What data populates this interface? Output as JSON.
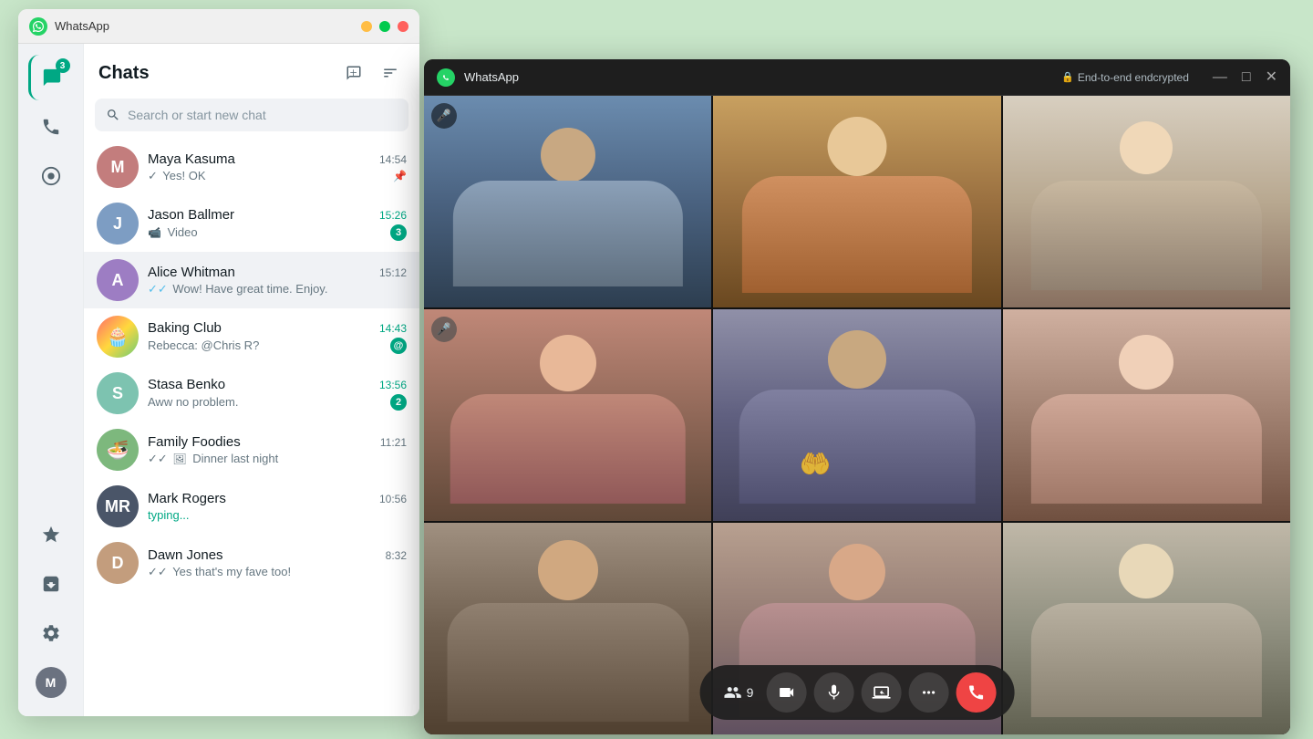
{
  "outerWindow": {
    "titlebar": {
      "appName": "WhatsApp",
      "controls": {
        "minimize": "—",
        "maximize": "□",
        "close": "✕"
      }
    }
  },
  "sidebar": {
    "badge": "3",
    "items": [
      {
        "id": "chats",
        "label": "Chats",
        "icon": "chat"
      },
      {
        "id": "calls",
        "label": "Calls",
        "icon": "phone"
      },
      {
        "id": "status",
        "label": "Status",
        "icon": "circle"
      }
    ],
    "bottomItems": [
      {
        "id": "favorites",
        "label": "Favorites",
        "icon": "star"
      },
      {
        "id": "archived",
        "label": "Archived",
        "icon": "archive"
      },
      {
        "id": "settings",
        "label": "Settings",
        "icon": "gear"
      },
      {
        "id": "profile",
        "label": "Profile",
        "icon": "avatar"
      }
    ]
  },
  "chatsPanel": {
    "title": "Chats",
    "newChatLabel": "New chat",
    "filterLabel": "Filter",
    "search": {
      "placeholder": "Search or start new chat"
    },
    "conversations": [
      {
        "id": "maya",
        "name": "Maya Kasuma",
        "time": "14:54",
        "preview": "Yes! OK",
        "pinned": true,
        "unread": 0,
        "tick": "single"
      },
      {
        "id": "jason",
        "name": "Jason Ballmer",
        "time": "15:26",
        "preview": "Video",
        "hasVideo": true,
        "unread": 3,
        "tick": ""
      },
      {
        "id": "alice",
        "name": "Alice Whitman",
        "time": "15:12",
        "preview": "Wow! Have great time. Enjoy.",
        "unread": 0,
        "tick": "double",
        "active": true
      },
      {
        "id": "baking",
        "name": "Baking Club",
        "time": "14:43",
        "preview": "Rebecca: @Chris R?",
        "unread": 1,
        "mention": true,
        "tick": ""
      },
      {
        "id": "stasa",
        "name": "Stasa Benko",
        "time": "13:56",
        "preview": "Aww no problem.",
        "unread": 2,
        "tick": ""
      },
      {
        "id": "family",
        "name": "Family Foodies",
        "time": "11:21",
        "preview": "Dinner last night",
        "unread": 0,
        "tick": "double",
        "hasImage": true
      },
      {
        "id": "mark",
        "name": "Mark Rogers",
        "time": "10:56",
        "preview": "typing...",
        "typing": true,
        "unread": 0
      },
      {
        "id": "dawn",
        "name": "Dawn Jones",
        "time": "8:32",
        "preview": "Yes that's my fave too!",
        "unread": 0,
        "tick": "double"
      }
    ]
  },
  "videoWindow": {
    "titlebar": {
      "appName": "WhatsApp",
      "encryptionLabel": "End-to-end endcrypted",
      "controls": {
        "minimize": "—",
        "maximize": "□",
        "close": "✕"
      }
    },
    "participants": [
      {
        "id": 1,
        "muted": true,
        "highlighted": false,
        "faceClass": "face-1"
      },
      {
        "id": 2,
        "muted": false,
        "highlighted": false,
        "faceClass": "face-2"
      },
      {
        "id": 3,
        "muted": false,
        "highlighted": false,
        "faceClass": "face-3"
      },
      {
        "id": 4,
        "muted": true,
        "highlighted": false,
        "faceClass": "face-4"
      },
      {
        "id": 5,
        "muted": false,
        "highlighted": true,
        "faceClass": "face-5"
      },
      {
        "id": 6,
        "muted": false,
        "highlighted": false,
        "faceClass": "face-6"
      },
      {
        "id": 7,
        "muted": false,
        "highlighted": false,
        "faceClass": "face-7"
      },
      {
        "id": 8,
        "muted": false,
        "highlighted": false,
        "faceClass": "face-8"
      },
      {
        "id": 9,
        "muted": false,
        "highlighted": false,
        "faceClass": "face-9"
      }
    ],
    "controls": {
      "participantCount": "9",
      "participantIcon": "👥",
      "cameraLabel": "Camera",
      "micLabel": "Microphone",
      "screenShareLabel": "Screen share",
      "moreLabel": "More",
      "endCallLabel": "End call"
    }
  }
}
